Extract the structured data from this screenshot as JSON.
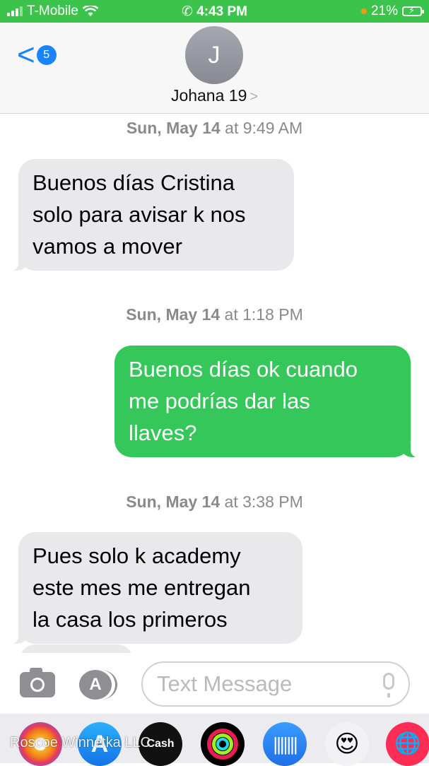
{
  "status_bar": {
    "carrier": "T-Mobile",
    "time": "4:43 PM",
    "battery": "21%",
    "icons": [
      "signal-bars-icon",
      "wifi-icon",
      "phone-call-icon",
      "orange-dot-icon",
      "battery-charging-icon"
    ]
  },
  "header": {
    "back_chevron": "<",
    "back_count": "5",
    "avatar_initial": "J",
    "contact_name": "Johana 19",
    "contact_chevron": ">"
  },
  "messages": [
    {
      "timestamp_day": "Sun, May 14",
      "timestamp_time": "at 9:49 AM",
      "direction": "incoming",
      "lines": [
        "Buenos días Cristina",
        "solo para avisar k nos",
        "vamos a mover"
      ]
    },
    {
      "timestamp_day": "Sun, May 14",
      "timestamp_time": "at 1:18 PM",
      "direction": "outgoing",
      "lines": [
        "Buenos días ok cuando",
        "me podrías dar las",
        "llaves?"
      ]
    },
    {
      "timestamp_day": "Sun, May 14",
      "timestamp_time": "at 3:38 PM",
      "direction": "incoming",
      "lines": [
        "Pues solo k academy",
        "este mes me entregan",
        "la casa los primeros"
      ]
    }
  ],
  "input": {
    "placeholder": "Text Message",
    "icons": [
      "camera-icon",
      "app-store-icon",
      "microphone-icon"
    ]
  },
  "app_tray": {
    "apps": [
      "photos-app-icon",
      "app-store-app-icon",
      "cash-app-icon",
      "activity-app-icon",
      "audio-message-app-icon",
      "memoji-app-icon",
      "web-search-app-icon"
    ],
    "cash_label": "Cash"
  },
  "watermark": "Roscoe Winnetka LLC",
  "colors": {
    "status_bar": "#3cc34b",
    "outgoing_bubble": "#35c75a",
    "incoming_bubble": "#e9e9eb",
    "accent_blue": "#1a84ff"
  }
}
